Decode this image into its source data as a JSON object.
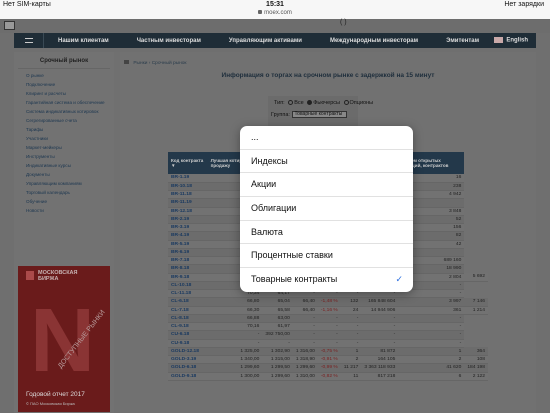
{
  "status_bar": {
    "carrier": "Нет SIM-карты",
    "time": "15:31",
    "battery": "Нет зарядки"
  },
  "url": "moex.com",
  "header": {
    "phone": "( ) "
  },
  "nav": {
    "items": [
      "Нашим клиентам",
      "Частным инвесторам",
      "Управляющим активами",
      "Международным инвесторам",
      "Эмитентам"
    ],
    "language": "English"
  },
  "sidebar": {
    "title": "Срочный рынок",
    "items": [
      "О рынке",
      "Подключение",
      "Клиринг и расчеты",
      "Гарантийная система и обеспечение",
      "Система индикативных котировок",
      "Сегрегированные счета",
      "Тарифы",
      "Участники",
      "Маркет-мейкеры",
      "Инструменты",
      "Индикативные курсы",
      "Документы",
      "Управляющим компаниям",
      "Торговый календарь",
      "Обучение",
      "Новости"
    ]
  },
  "promo": {
    "brand_line1": "МОСКОВСКАЯ",
    "brand_line2": "БИРЖА",
    "big_letter": "N",
    "diagonal": "ДОСТУПНЫЕ РЫНКИ",
    "report": "Годовой отчет 2017",
    "rights": "© ПАО Московская Биржа"
  },
  "breadcrumb": [
    "Рынки",
    "Срочный рынок"
  ],
  "page_title": "Информация о торгах на срочном рынке с задержкой на 15 минут",
  "filters": {
    "type_label": "Тип:",
    "types": [
      "Все",
      "Фьючерсы",
      "Опционы"
    ],
    "selected_type": "Фьючерсы",
    "group_label": "Группа:",
    "group_value": "Товарные контракты"
  },
  "table": {
    "headers": [
      "Код контракта ▼",
      "Лучшая котировка на продажу",
      "",
      "",
      "",
      "",
      "контрактов",
      "Объем открытых позиций, контрактов"
    ],
    "rows": [
      [
        "BR-1.19",
        "76,",
        "",
        "",
        "",
        "",
        "1",
        "16"
      ],
      [
        "BR-10.18",
        "76,",
        "",
        "",
        "",
        "",
        "9",
        "238"
      ],
      [
        "BR-11.18",
        "77,",
        "",
        "",
        "",
        "",
        "",
        "4 942"
      ],
      [
        "BR-11.19",
        "74,",
        "",
        "",
        "",
        "",
        "",
        ""
      ],
      [
        "BR-12.18",
        "76,",
        "",
        "",
        "",
        "",
        "11",
        "3 848"
      ],
      [
        "BR-2.19",
        "75,",
        "",
        "",
        "",
        "",
        "2",
        "52"
      ],
      [
        "BR-3.19",
        "74,",
        "",
        "",
        "",
        "",
        "2",
        "156"
      ],
      [
        "BR-4.19",
        "74,",
        "",
        "",
        "",
        "",
        "2",
        "82"
      ],
      [
        "BR-5.19",
        "74,",
        "",
        "",
        "",
        "",
        "3",
        "42"
      ],
      [
        "BR-6.19",
        "75,",
        "",
        "",
        "",
        "",
        "",
        ""
      ],
      [
        "BR-7.18",
        "",
        "",
        "",
        "",
        "",
        "1 946 487",
        "689 160"
      ],
      [
        "BR-8.18",
        "76,2",
        "",
        "",
        "",
        "",
        "15 787",
        "18 990"
      ],
      [
        "BR-9.18",
        "77,00",
        "75,65",
        "75,85",
        "-1,61 %",
        "152",
        "133 632 298",
        "2 804",
        "5 692"
      ],
      [
        "CL-10.18",
        "70,41",
        "-",
        "-",
        "-",
        "-",
        "-",
        "-"
      ],
      [
        "CL-11.18",
        "70,34",
        "64,17",
        "-",
        "-",
        "-",
        "-",
        "-"
      ],
      [
        "CL-6.18",
        "66,80",
        "65,04",
        "66,40",
        "-1,48 %",
        "132",
        "165 848 604",
        "3 997",
        "7 146"
      ],
      [
        "CL-7.18",
        "66,30",
        "65,58",
        "66,40",
        "-1,16 %",
        "24",
        "14 944 906",
        "361",
        "1 214"
      ],
      [
        "CL-8.18",
        "66,88",
        "63,00",
        "-",
        "-",
        "-",
        "-",
        "-"
      ],
      [
        "CL-9.18",
        "70,16",
        "61,97",
        "-",
        "-",
        "-",
        "-",
        "-"
      ],
      [
        "CU-6.18",
        "-",
        "392 750,00",
        "-",
        "-",
        "-",
        "-",
        "-"
      ],
      [
        "CU-9.18",
        "-",
        "-",
        "-",
        "-",
        "-",
        "-",
        "-"
      ],
      [
        "GOLD-12.18",
        "1 325,00",
        "1 302,90",
        "1 316,00",
        "-0,75 %",
        "1",
        "81 872",
        "1",
        "364"
      ],
      [
        "GOLD-3.19",
        "1 340,00",
        "1 315,00",
        "1 318,90",
        "-0,91 %",
        "2",
        "164 105",
        "2",
        "108"
      ],
      [
        "GOLD-6.18",
        "1 299,60",
        "1 299,50",
        "1 299,60",
        "-0,99 %",
        "11 217",
        "3 363 118 933",
        "41 620",
        "184 198"
      ],
      [
        "GOLD-9.18",
        "1 300,00",
        "1 299,60",
        "1 310,00",
        "-0,82 %",
        "11",
        "817 218",
        "6",
        "2 122"
      ]
    ]
  },
  "dropdown": {
    "options": [
      "...",
      "Индексы",
      "Акции",
      "Облигации",
      "Валюта",
      "Процентные ставки",
      "Товарные контракты"
    ],
    "selected_index": 6,
    "check_glyph": "✓"
  }
}
